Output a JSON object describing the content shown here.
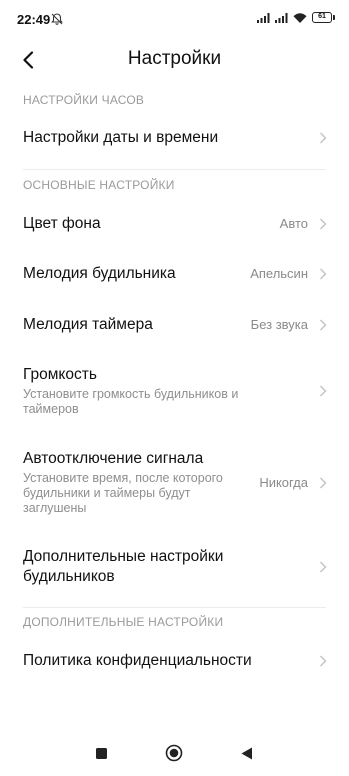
{
  "status_bar": {
    "time": "22:49",
    "battery": "61",
    "icons": [
      "mute-bell-icon",
      "signal-icon",
      "signal-icon",
      "wifi-icon",
      "battery-icon"
    ]
  },
  "header": {
    "back_icon": "back-arrow-icon",
    "title": "Настройки"
  },
  "sections": {
    "clock": {
      "header": "НАСТРОЙКИ ЧАСОВ",
      "date_time": {
        "title": "Настройки даты и времени"
      }
    },
    "basic": {
      "header": "ОСНОВНЫЕ НАСТРОЙКИ",
      "background": {
        "title": "Цвет фона",
        "value": "Авто"
      },
      "alarm_melody": {
        "title": "Мелодия будильника",
        "value": "Апельсин"
      },
      "timer_melody": {
        "title": "Мелодия таймера",
        "value": "Без звука"
      },
      "volume": {
        "title": "Громкость",
        "subtitle_1": "Установите громкость будильников и",
        "subtitle_2": "таймеров"
      },
      "auto_off": {
        "title": "Автоотключение сигнала",
        "subtitle_1": "Установите время, после которого",
        "subtitle_2": "будильники и таймеры будут",
        "subtitle_3": "заглушены",
        "value": "Никогда"
      },
      "extra_alarm": {
        "title_1": "Дополнительные настройки",
        "title_2": "будильников"
      }
    },
    "additional": {
      "header": "ДОПОЛНИТЕЛЬНЫЕ НАСТРОЙКИ",
      "privacy": {
        "title": "Политика конфиденциальности"
      }
    }
  },
  "nav_bar": {
    "icons": [
      "recents-square-icon",
      "home-circle-icon",
      "back-triangle-icon"
    ]
  },
  "colors": {
    "text": "#111111",
    "secondary": "#8e8e8e",
    "section": "#9a9a9a",
    "chevron": "#c2c2c2"
  }
}
